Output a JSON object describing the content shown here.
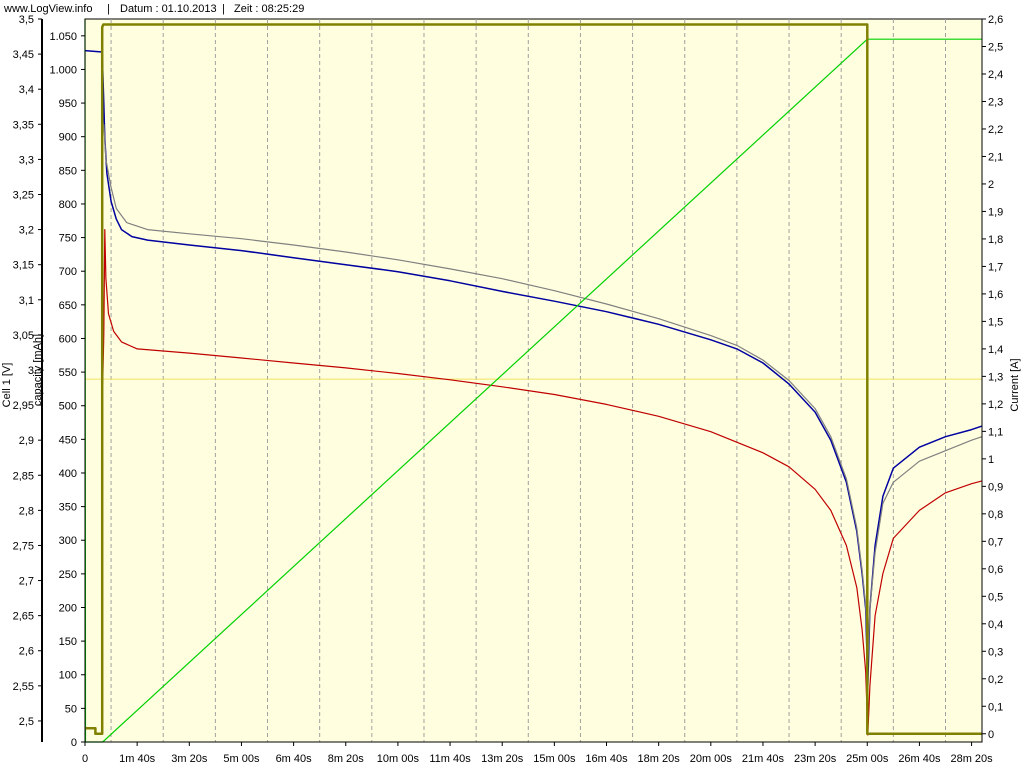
{
  "header": {
    "site": "www.LogView.info",
    "date_label": "Datum : 01.10.2013",
    "time_label": "Zeit : 08:25:29",
    "separator": "|"
  },
  "axes": {
    "left_voltage_label": "Cell 1 [V]",
    "left_capacity_label": "capacity [mAh]",
    "right_label": "Current [A]"
  },
  "chart_data": {
    "type": "line",
    "title": "",
    "xlabel": "",
    "x_unit": "seconds",
    "xlim": [
      0,
      1720
    ],
    "grid": true,
    "plot_background": "#ffffe0",
    "y_axes": [
      {
        "name": "Cell 1 [V]",
        "side": "left",
        "lim": [
          2.47,
          3.5
        ],
        "ticks": [
          [
            "2,5",
            2.5
          ],
          [
            "2,55",
            2.55
          ],
          [
            "2,6",
            2.6
          ],
          [
            "2,65",
            2.65
          ],
          [
            "2,7",
            2.7
          ],
          [
            "2,75",
            2.75
          ],
          [
            "2,8",
            2.8
          ],
          [
            "2,85",
            2.85
          ],
          [
            "2,9",
            2.9
          ],
          [
            "2,95",
            2.95
          ],
          [
            "3",
            3.0
          ],
          [
            "3,05",
            3.05
          ],
          [
            "3,1",
            3.1
          ],
          [
            "3,15",
            3.15
          ],
          [
            "3,2",
            3.2
          ],
          [
            "3,25",
            3.25
          ],
          [
            "3,3",
            3.3
          ],
          [
            "3,35",
            3.35
          ],
          [
            "3,4",
            3.4
          ],
          [
            "3,45",
            3.45
          ],
          [
            "3,5",
            3.5
          ]
        ]
      },
      {
        "name": "capacity [mAh]",
        "side": "left",
        "lim": [
          0,
          1075
        ],
        "ticks": [
          [
            "0",
            0
          ],
          [
            "50",
            50
          ],
          [
            "100",
            100
          ],
          [
            "150",
            150
          ],
          [
            "200",
            200
          ],
          [
            "250",
            250
          ],
          [
            "300",
            300
          ],
          [
            "350",
            350
          ],
          [
            "400",
            400
          ],
          [
            "450",
            450
          ],
          [
            "500",
            500
          ],
          [
            "550",
            550
          ],
          [
            "600",
            600
          ],
          [
            "650",
            650
          ],
          [
            "700",
            700
          ],
          [
            "750",
            750
          ],
          [
            "800",
            800
          ],
          [
            "850",
            850
          ],
          [
            "900",
            900
          ],
          [
            "950",
            950
          ],
          [
            "1.000",
            1000
          ],
          [
            "1.050",
            1050
          ]
        ]
      },
      {
        "name": "Current [A]",
        "side": "right",
        "lim": [
          -0.03,
          2.6
        ],
        "ticks": [
          [
            "0",
            0
          ],
          [
            "0,1",
            0.1
          ],
          [
            "0,2",
            0.2
          ],
          [
            "0,3",
            0.3
          ],
          [
            "0,4",
            0.4
          ],
          [
            "0,5",
            0.5
          ],
          [
            "0,6",
            0.6
          ],
          [
            "0,7",
            0.7
          ],
          [
            "0,8",
            0.8
          ],
          [
            "0,9",
            0.9
          ],
          [
            "1",
            1.0
          ],
          [
            "1,1",
            1.1
          ],
          [
            "1,2",
            1.2
          ],
          [
            "1,3",
            1.3
          ],
          [
            "1,4",
            1.4
          ],
          [
            "1,5",
            1.5
          ],
          [
            "1,6",
            1.6
          ],
          [
            "1,7",
            1.7
          ],
          [
            "1,8",
            1.8
          ],
          [
            "1,9",
            1.9
          ],
          [
            "2",
            2.0
          ],
          [
            "2,1",
            2.1
          ],
          [
            "2,2",
            2.2
          ],
          [
            "2,3",
            2.3
          ],
          [
            "2,4",
            2.4
          ],
          [
            "2,5",
            2.5
          ],
          [
            "2,6",
            2.6
          ]
        ]
      }
    ],
    "x_ticks": [
      [
        "0",
        0
      ],
      [
        "1m 40s",
        100
      ],
      [
        "3m 20s",
        200
      ],
      [
        "5m 00s",
        300
      ],
      [
        "6m 40s",
        400
      ],
      [
        "8m 20s",
        500
      ],
      [
        "10m 00s",
        600
      ],
      [
        "11m 40s",
        700
      ],
      [
        "13m 20s",
        800
      ],
      [
        "15m 00s",
        900
      ],
      [
        "16m 40s",
        1000
      ],
      [
        "18m 20s",
        1100
      ],
      [
        "20m 00s",
        1200
      ],
      [
        "21m 40s",
        1300
      ],
      [
        "23m 20s",
        1400
      ],
      [
        "25m 00s",
        1500
      ],
      [
        "26m 40s",
        1600
      ],
      [
        "28m 20s",
        1700
      ]
    ],
    "x_grid": [
      50,
      150,
      250,
      350,
      450,
      550,
      650,
      750,
      850,
      950,
      1050,
      1150,
      1250,
      1350,
      1450,
      1550,
      1650
    ],
    "hline": {
      "axis": 2,
      "value": 1.29,
      "color": "#f0e060"
    },
    "series": [
      {
        "axis": 0,
        "color": "#0000a0",
        "width": 1.5,
        "points": [
          [
            0,
            3.455
          ],
          [
            33,
            3.453
          ],
          [
            36,
            3.38
          ],
          [
            38,
            3.33
          ],
          [
            42,
            3.28
          ],
          [
            50,
            3.24
          ],
          [
            60,
            3.215
          ],
          [
            70,
            3.2
          ],
          [
            90,
            3.19
          ],
          [
            120,
            3.185
          ],
          [
            200,
            3.178
          ],
          [
            300,
            3.17
          ],
          [
            400,
            3.16
          ],
          [
            500,
            3.15
          ],
          [
            600,
            3.14
          ],
          [
            700,
            3.127
          ],
          [
            800,
            3.112
          ],
          [
            900,
            3.098
          ],
          [
            1000,
            3.083
          ],
          [
            1100,
            3.065
          ],
          [
            1200,
            3.043
          ],
          [
            1250,
            3.03
          ],
          [
            1300,
            3.01
          ],
          [
            1350,
            2.98
          ],
          [
            1400,
            2.94
          ],
          [
            1430,
            2.9
          ],
          [
            1460,
            2.84
          ],
          [
            1480,
            2.77
          ],
          [
            1490,
            2.71
          ],
          [
            1497,
            2.66
          ],
          [
            1501,
            2.55
          ],
          [
            1505,
            2.66
          ],
          [
            1515,
            2.75
          ],
          [
            1530,
            2.82
          ],
          [
            1550,
            2.86
          ],
          [
            1600,
            2.89
          ],
          [
            1650,
            2.905
          ],
          [
            1700,
            2.915
          ],
          [
            1720,
            2.92
          ]
        ]
      },
      {
        "axis": 0,
        "color": "#808080",
        "width": 1.2,
        "points": [
          [
            36,
            3.35
          ],
          [
            40,
            3.3
          ],
          [
            50,
            3.26
          ],
          [
            60,
            3.23
          ],
          [
            80,
            3.21
          ],
          [
            120,
            3.2
          ],
          [
            200,
            3.194
          ],
          [
            300,
            3.187
          ],
          [
            400,
            3.178
          ],
          [
            500,
            3.168
          ],
          [
            600,
            3.157
          ],
          [
            700,
            3.144
          ],
          [
            800,
            3.13
          ],
          [
            900,
            3.113
          ],
          [
            1000,
            3.094
          ],
          [
            1100,
            3.073
          ],
          [
            1200,
            3.049
          ],
          [
            1250,
            3.035
          ],
          [
            1300,
            3.014
          ],
          [
            1350,
            2.985
          ],
          [
            1400,
            2.945
          ],
          [
            1430,
            2.905
          ],
          [
            1460,
            2.845
          ],
          [
            1480,
            2.775
          ],
          [
            1490,
            2.715
          ],
          [
            1497,
            2.665
          ],
          [
            1501,
            2.58
          ],
          [
            1505,
            2.66
          ],
          [
            1515,
            2.74
          ],
          [
            1530,
            2.81
          ],
          [
            1550,
            2.84
          ],
          [
            1600,
            2.87
          ],
          [
            1650,
            2.885
          ],
          [
            1700,
            2.9
          ],
          [
            1720,
            2.905
          ]
        ]
      },
      {
        "axis": 0,
        "color": "#c00000",
        "width": 1.2,
        "points": [
          [
            34,
            2.98
          ],
          [
            36,
            3.05
          ],
          [
            38,
            3.2
          ],
          [
            40,
            3.13
          ],
          [
            45,
            3.08
          ],
          [
            55,
            3.055
          ],
          [
            70,
            3.04
          ],
          [
            100,
            3.03
          ],
          [
            200,
            3.024
          ],
          [
            300,
            3.017
          ],
          [
            400,
            3.01
          ],
          [
            500,
            3.003
          ],
          [
            600,
            2.995
          ],
          [
            700,
            2.986
          ],
          [
            800,
            2.976
          ],
          [
            900,
            2.965
          ],
          [
            1000,
            2.951
          ],
          [
            1100,
            2.934
          ],
          [
            1200,
            2.912
          ],
          [
            1300,
            2.882
          ],
          [
            1350,
            2.862
          ],
          [
            1400,
            2.83
          ],
          [
            1430,
            2.8
          ],
          [
            1460,
            2.75
          ],
          [
            1480,
            2.69
          ],
          [
            1490,
            2.63
          ],
          [
            1497,
            2.57
          ],
          [
            1501,
            2.48
          ],
          [
            1505,
            2.55
          ],
          [
            1515,
            2.65
          ],
          [
            1530,
            2.71
          ],
          [
            1550,
            2.76
          ],
          [
            1600,
            2.8
          ],
          [
            1650,
            2.825
          ],
          [
            1700,
            2.838
          ],
          [
            1720,
            2.842
          ]
        ]
      },
      {
        "axis": 1,
        "color": "#00d000",
        "width": 1.2,
        "points": [
          [
            0,
            1075
          ],
          [
            1,
            0
          ],
          [
            34,
            0
          ],
          [
            1500,
            1045
          ],
          [
            1720,
            1045
          ]
        ]
      },
      {
        "axis": 2,
        "color": "#808000",
        "width": 2.5,
        "points": [
          [
            0,
            0.02
          ],
          [
            20,
            0.02
          ],
          [
            20,
            0.0
          ],
          [
            33,
            0.0
          ],
          [
            33,
            2.57
          ],
          [
            35,
            2.58
          ],
          [
            1500,
            2.58
          ],
          [
            1500,
            0.0
          ],
          [
            1720,
            0.0
          ]
        ]
      }
    ]
  }
}
